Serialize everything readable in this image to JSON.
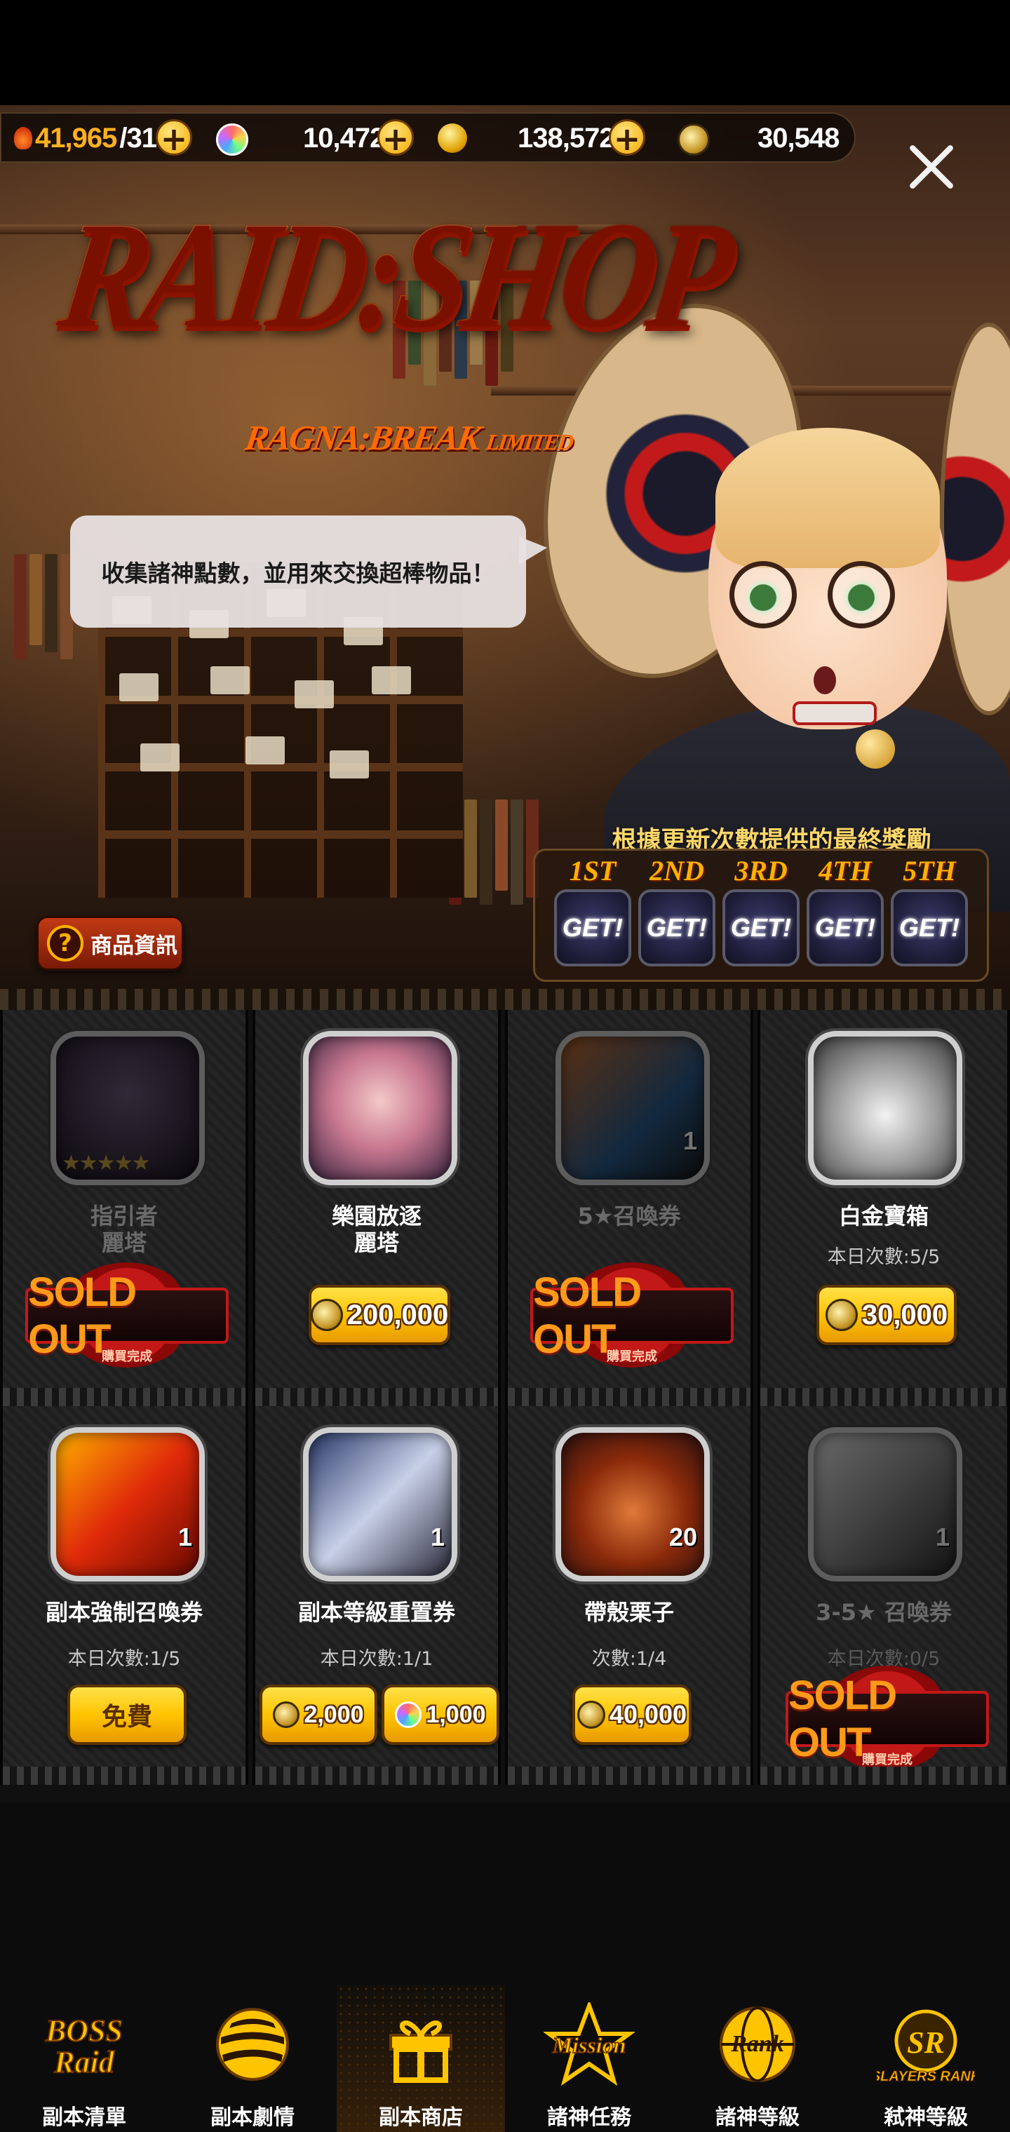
{
  "currencies": {
    "stamina": {
      "value": "41,965",
      "max": "/314",
      "icon": "flame-heart-icon"
    },
    "gems": {
      "value": "10,472",
      "icon": "rainbow-gem-icon"
    },
    "gold": {
      "value": "138,572",
      "icon": "gold-coin-stack-icon"
    },
    "raid_points": {
      "value": "30,548",
      "icon": "raid-medal-icon"
    }
  },
  "banner": {
    "logo_main": "RAID:SHOP",
    "logo_sub": "RAGNA:BREAK",
    "logo_sub_suffix": "LIMITED",
    "speech": "收集諸神點數，並用來交換超棒物品！",
    "rewards_title": "根據更新次數提供的最終獎勵",
    "ranks": [
      "1ST",
      "2ND",
      "3RD",
      "4TH",
      "5TH"
    ],
    "get_label": "GET!",
    "info_button": "商品資訊"
  },
  "shop": {
    "sold_out_label": "SOLD OUT",
    "sold_out_sub": "購買完成",
    "items": [
      {
        "name_line1": "指引者",
        "name_line2": "麗塔",
        "limit": "",
        "price": "",
        "sold_out": true,
        "stars": "★★★★★"
      },
      {
        "name_line1": "樂園放逐",
        "name_line2": "麗塔",
        "limit": "",
        "price": "200,000",
        "sold_out": false
      },
      {
        "name_line1": "5★召喚券",
        "name_line2": "",
        "limit": "",
        "price": "",
        "sold_out": true,
        "qty": "1"
      },
      {
        "name_line1": "白金寶箱",
        "name_line2": "",
        "limit": "本日次數:5/5",
        "price": "30,000",
        "sold_out": false
      },
      {
        "name_line1": "副本強制召喚券",
        "name_line2": "",
        "limit": "本日次數:1/5",
        "price": "免費",
        "sold_out": false,
        "qty": "1"
      },
      {
        "name_line1": "副本等級重置券",
        "name_line2": "",
        "limit": "本日次數:1/1",
        "price": "2,000",
        "price_alt": "1,000",
        "sold_out": false,
        "qty": "1"
      },
      {
        "name_line1": "帶殼栗子",
        "name_line2": "",
        "limit": "次數:1/4",
        "price": "40,000",
        "sold_out": false,
        "qty": "20"
      },
      {
        "name_line1": "3-5★ 召喚券",
        "name_line2": "",
        "limit": "本日次數:0/5",
        "price": "",
        "sold_out": true,
        "qty": "1"
      }
    ]
  },
  "nav": [
    {
      "label": "副本清單",
      "icon": "boss-raid-icon",
      "icon_text": "BOSS Raid"
    },
    {
      "label": "副本劇情",
      "icon": "striped-ball-icon",
      "icon_text": ""
    },
    {
      "label": "副本商店",
      "icon": "gift-box-icon",
      "icon_text": "",
      "active": true
    },
    {
      "label": "諸神任務",
      "icon": "mission-star-icon",
      "icon_text": "Mission"
    },
    {
      "label": "諸神等級",
      "icon": "rank-globe-icon",
      "icon_text": "Rank"
    },
    {
      "label": "弒神等級",
      "icon": "slayers-rank-icon",
      "icon_text": "SLAYERS RANK"
    }
  ],
  "colors": {
    "accent_gold": "#ffc400",
    "sold_out_red": "#c21818",
    "background": "#101010"
  }
}
